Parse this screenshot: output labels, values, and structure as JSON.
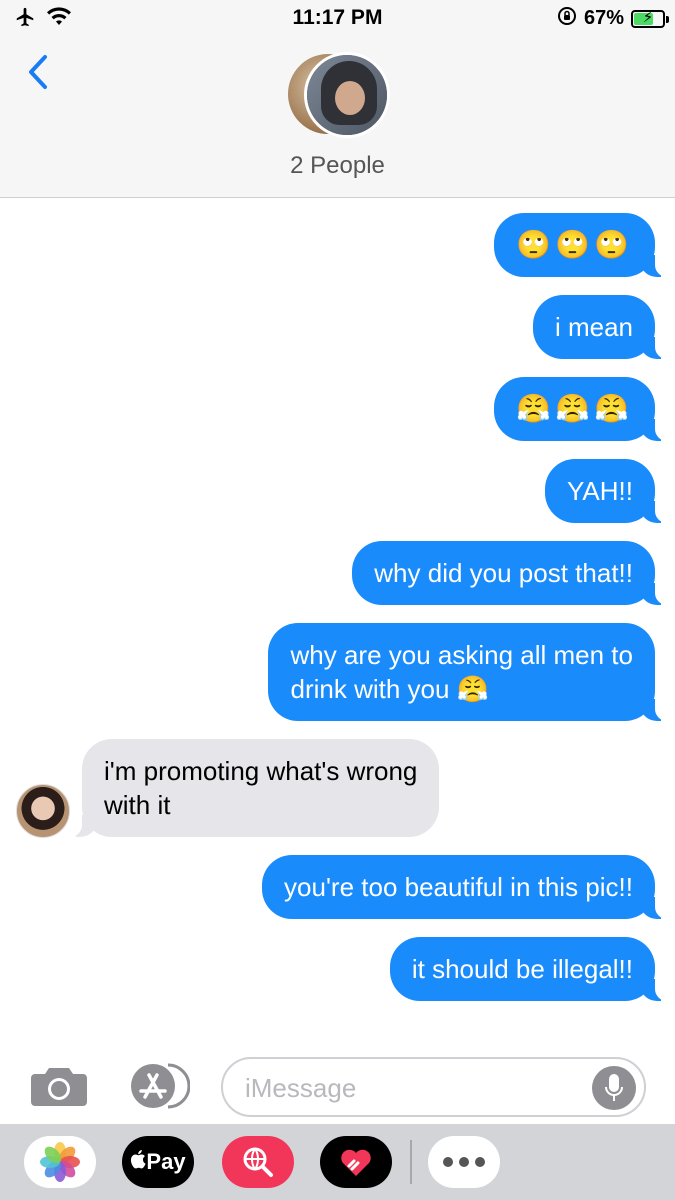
{
  "status_bar": {
    "time": "11:17 PM",
    "battery_percent": "67%",
    "battery_level": 0.67,
    "icons": [
      "airplane-icon",
      "wifi-icon",
      "orientation-lock-icon",
      "battery-charging-icon"
    ]
  },
  "header": {
    "title": "2 People",
    "back_icon": "chevron-left-icon"
  },
  "messages": [
    {
      "direction": "sent",
      "text": "🙄🙄🙄"
    },
    {
      "direction": "sent",
      "text": "i mean"
    },
    {
      "direction": "sent",
      "text": "😤😤😤"
    },
    {
      "direction": "sent",
      "text": "YAH!!"
    },
    {
      "direction": "sent",
      "text": "why did you post that!!"
    },
    {
      "direction": "sent",
      "text": "why are you asking all men to\ndrink with you 😤"
    },
    {
      "direction": "received",
      "text": "i'm promoting what's wrong\nwith it"
    },
    {
      "direction": "sent",
      "text": "you're too beautiful in this pic!!"
    },
    {
      "direction": "sent",
      "text": "it should be illegal!!"
    }
  ],
  "compose": {
    "placeholder": "iMessage",
    "value": ""
  },
  "app_drawer": {
    "apple_pay_label": "Pay",
    "apps": [
      "photos-app-icon",
      "apple-pay-icon",
      "web-search-icon",
      "digital-touch-icon",
      "more-apps-icon"
    ]
  },
  "colors": {
    "sent_bubble": "#1a8bfb",
    "received_bubble": "#e5e5ea",
    "accent": "#1a7cf5"
  }
}
